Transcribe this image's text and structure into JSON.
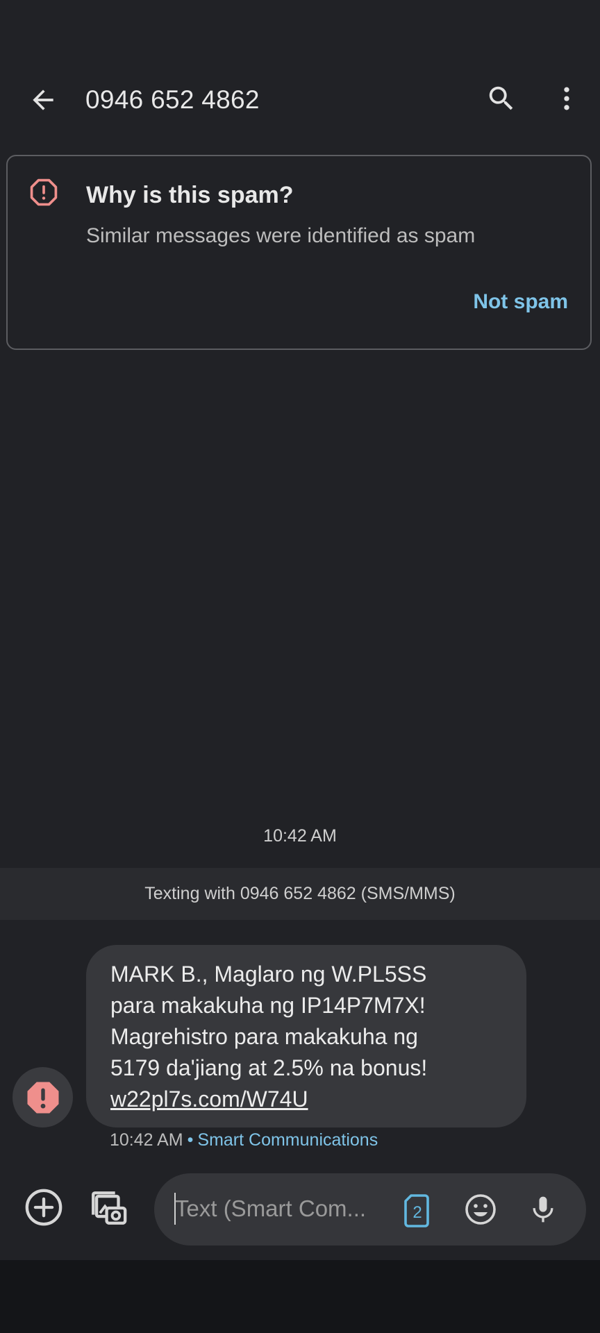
{
  "header": {
    "title": "0946 652 4862",
    "back_icon": "arrow-back-icon",
    "search_icon": "search-icon",
    "more_icon": "more-vert-icon"
  },
  "spam_card": {
    "title": "Why is this spam?",
    "description": "Similar messages were identified as spam",
    "action": "Not spam",
    "icon": "spam-warning-icon",
    "accent_color": "#ef8f8c",
    "link_color": "#7fc4e8"
  },
  "conversation": {
    "timestamp": "10:42 AM",
    "texting_banner": "Texting with 0946 652 4862 (SMS/MMS)",
    "message": {
      "lines": [
        "MARK B., Maglaro ng W.PL5SS",
        "para makakuha ng IP14P7M7X!",
        "Magrehistro para makakuha ng",
        "5179 da'jiang at 2.5% na bonus!"
      ],
      "link": "w22pl7s.com/W74U",
      "time": "10:42 AM",
      "separator": "•",
      "carrier": "Smart Communications",
      "avatar_icon": "spam-avatar-icon"
    }
  },
  "compose": {
    "placeholder": "Text (Smart Com...",
    "sim_label": "2",
    "add_icon": "add-circle-icon",
    "media_icon": "gallery-camera-icon",
    "emoji_icon": "emoji-icon",
    "mic_icon": "mic-icon"
  }
}
